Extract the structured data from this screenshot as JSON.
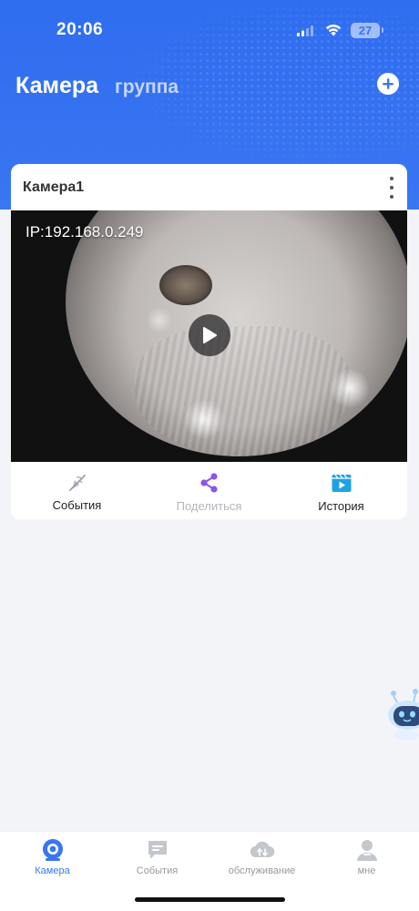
{
  "status_bar": {
    "time": "20:06",
    "battery": "27"
  },
  "header": {
    "tab_active": "Камера",
    "tab_inactive": "группа",
    "add_icon": "plus-circle-icon"
  },
  "camera_card": {
    "name": "Камера1",
    "ip_overlay": "IP:192.168.0.249",
    "actions": [
      {
        "label": "События",
        "icon": "events-crossed-icon",
        "color": "#9aa0a8",
        "enabled": true
      },
      {
        "label": "Поделиться",
        "icon": "share-icon",
        "color": "#8a57e8",
        "enabled": false
      },
      {
        "label": "История",
        "icon": "history-video-icon",
        "color": "#1fa3e0",
        "enabled": true
      }
    ]
  },
  "bottom_nav": [
    {
      "label": "Камера",
      "icon": "camera-icon",
      "active": true
    },
    {
      "label": "События",
      "icon": "message-icon",
      "active": false
    },
    {
      "label": "обслуживание",
      "icon": "cloud-service-icon",
      "active": false
    },
    {
      "label": "мне",
      "icon": "person-icon",
      "active": false
    }
  ],
  "colors": {
    "brand": "#3a76f2",
    "background": "#f3f4f8"
  }
}
